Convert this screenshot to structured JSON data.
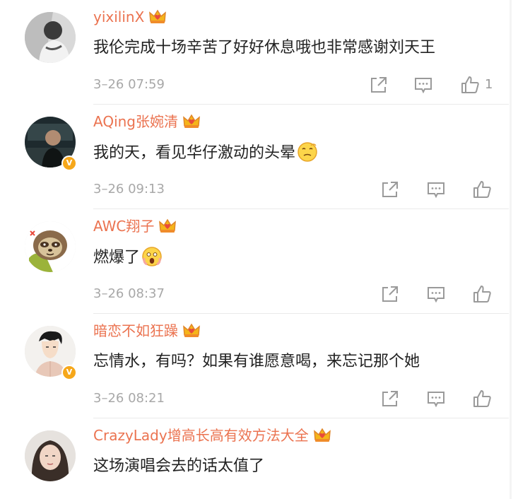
{
  "comments": [
    {
      "username": "yixilinX",
      "text": "我伦完成十场辛苦了好好休息哦也非常感谢刘天王",
      "time": "3–26 07:59",
      "likes": "1",
      "verified": false,
      "emoji": "",
      "avatar_icon": "avatar-photo-bw"
    },
    {
      "username": "AQing张婉清",
      "text": "我的天，看见华仔激动的头晕",
      "time": "3–26 09:13",
      "likes": "",
      "verified": true,
      "emoji": "dizzy-face",
      "avatar_icon": "avatar-photo-car"
    },
    {
      "username": "AWC翔子",
      "text": "燃爆了",
      "time": "3–26 08:37",
      "likes": "",
      "verified": false,
      "emoji": "screaming-face",
      "avatar_icon": "avatar-sloth"
    },
    {
      "username": "暗恋不如狂躁",
      "text": "忘情水，有吗？如果有谁愿意喝，来忘记那个她",
      "time": "3–26 08:21",
      "likes": "",
      "verified": true,
      "emoji": "",
      "avatar_icon": "avatar-illustration"
    },
    {
      "username": "CrazyLady增高长高有效方法大全",
      "text": "这场演唱会去的话太值了",
      "time": "",
      "likes": "",
      "verified": false,
      "emoji": "",
      "avatar_icon": "avatar-photo-girl"
    }
  ],
  "actions": {
    "share_icon": "share-icon",
    "reply_icon": "comment-icon",
    "like_icon": "thumbs-up-icon"
  },
  "colors": {
    "username": "#eb7350",
    "text": "#222222",
    "meta": "#a8a8a8",
    "badge": "#f6a71a"
  }
}
